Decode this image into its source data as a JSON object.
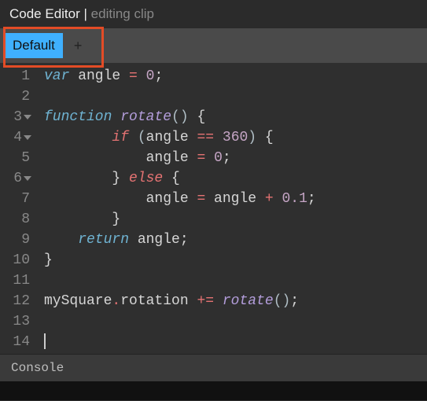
{
  "header": {
    "title": "Code Editor",
    "separator": " | ",
    "subtitle": "editing clip"
  },
  "tabs": {
    "active": "Default",
    "add_label": "+"
  },
  "gutter": {
    "lines": [
      "1",
      "2",
      "3",
      "4",
      "5",
      "6",
      "7",
      "8",
      "9",
      "10",
      "11",
      "12",
      "13",
      "14"
    ],
    "foldable": [
      3,
      4,
      6
    ]
  },
  "code": {
    "lines": [
      [
        [
          "kw",
          "var"
        ],
        [
          "id",
          " angle "
        ],
        [
          "op",
          "="
        ],
        [
          "id",
          " "
        ],
        [
          "num",
          "0"
        ],
        [
          "id",
          ";"
        ]
      ],
      [],
      [
        [
          "kw",
          "function"
        ],
        [
          "id",
          " "
        ],
        [
          "fn",
          "rotate"
        ],
        [
          "paren",
          "()"
        ],
        [
          "id",
          " {"
        ]
      ],
      [
        [
          "id",
          "        "
        ],
        [
          "kw2",
          "if"
        ],
        [
          "id",
          " "
        ],
        [
          "paren",
          "("
        ],
        [
          "id",
          "angle "
        ],
        [
          "op",
          "=="
        ],
        [
          "id",
          " "
        ],
        [
          "num",
          "360"
        ],
        [
          "paren",
          ")"
        ],
        [
          "id",
          " {"
        ]
      ],
      [
        [
          "id",
          "            angle "
        ],
        [
          "op",
          "="
        ],
        [
          "id",
          " "
        ],
        [
          "num",
          "0"
        ],
        [
          "id",
          ";"
        ]
      ],
      [
        [
          "id",
          "        } "
        ],
        [
          "kw2",
          "else"
        ],
        [
          "id",
          " {"
        ]
      ],
      [
        [
          "id",
          "            angle "
        ],
        [
          "op",
          "="
        ],
        [
          "id",
          " angle "
        ],
        [
          "op",
          "+"
        ],
        [
          "id",
          " "
        ],
        [
          "num",
          "0.1"
        ],
        [
          "id",
          ";"
        ]
      ],
      [
        [
          "id",
          "        }"
        ]
      ],
      [
        [
          "id",
          "    "
        ],
        [
          "kw",
          "return"
        ],
        [
          "id",
          " angle;"
        ]
      ],
      [
        [
          "id",
          "}"
        ]
      ],
      [],
      [
        [
          "id",
          "mySquare"
        ],
        [
          "dot",
          "."
        ],
        [
          "id",
          "rotation "
        ],
        [
          "op",
          "+="
        ],
        [
          "id",
          " "
        ],
        [
          "fn",
          "rotate"
        ],
        [
          "paren",
          "()"
        ],
        [
          "id",
          ";"
        ]
      ],
      [],
      [
        [
          "cursor",
          ""
        ]
      ]
    ]
  },
  "console": {
    "label": "Console"
  }
}
